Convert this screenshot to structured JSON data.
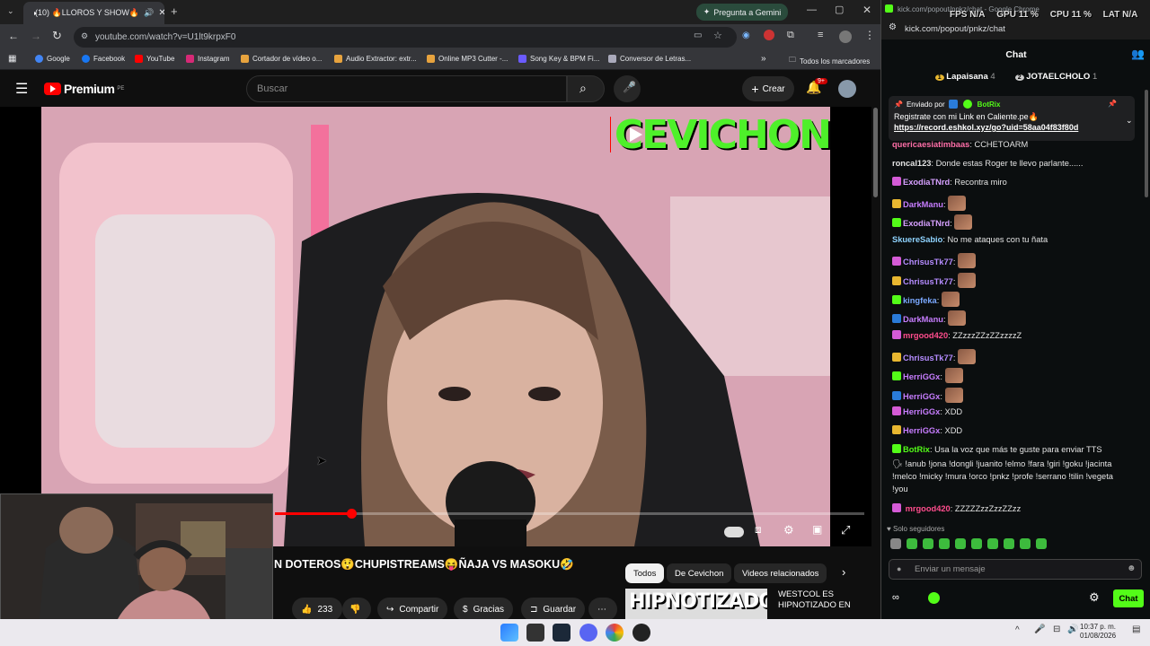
{
  "colors": {
    "youtube_red": "#ff0000",
    "kick_green": "#53fc18",
    "chat_green": "#4ef02a"
  },
  "browser": {
    "tab_title": "(10) 🔥LLOROS Y SHOW🔥",
    "gemini_label": "Pregunta a Gemini",
    "url": "youtube.com/watch?v=U1lt9krpxF0",
    "bookmarks": [
      "Google",
      "Facebook",
      "YouTube",
      "Instagram",
      "Cortador de vídeo o...",
      "Audio Extractor: extr...",
      "Online MP3 Cutter -...",
      "Song Key & BPM Fi...",
      "Conversor de Letras..."
    ],
    "all_bookmarks": "Todos los marcadores",
    "notif_badge": "9+"
  },
  "youtube": {
    "logo": "Premium",
    "logo_region": "PE",
    "search_placeholder": "Buscar",
    "create_label": "Crear",
    "notif_count": "9+",
    "overlay_logo_text": "CEVICHON",
    "progress": 0.13,
    "video_title": "N DOTEROS😲CHUPISTREAMS😝ÑAJA VS MASOKU🤣",
    "chips": [
      "Todos",
      "De Cevichon",
      "Videos relacionados"
    ],
    "likes": "233",
    "share": "Compartir",
    "thanks": "Gracias",
    "save": "Guardar",
    "rec_title": "WESTCOL ES HIPNOTIZADO EN",
    "rec_thumb_text": "HIPNOTIZADO"
  },
  "kick": {
    "window_title": "kick.com/popout/pnkz/chat - Google Chrome",
    "url": "kick.com/popout/pnkz/chat",
    "overlay": {
      "fps_label": "FPS",
      "fps": "N/A",
      "gpu_label": "GPU",
      "gpu": "11 %",
      "cpu_label": "CPU",
      "cpu": "11 %",
      "lat_label": "LAT",
      "lat": "N/A"
    },
    "chat_title": "Chat",
    "top1": {
      "rank": "1",
      "name": "Lapaisana",
      "count": "4"
    },
    "top2": {
      "rank": "2",
      "name": "JOTAELCHOLO",
      "count": "1"
    },
    "pinned_by": "Enviado por",
    "pinned_user": "BotRix",
    "pinned_text": "Registrate con mi Link en Caliente.pe🔥",
    "pinned_link": "https://record.eshkol.xyz/go?uid=58aa04f83f80d",
    "partial_user": "quericaesiatimbaas",
    "partial_text": "CCHETOARM",
    "messages": [
      {
        "user": "roncal123",
        "text": "Donde estas Roger te llevo parlante......",
        "color": "#e4e4e4"
      },
      {
        "user": "ExodiaTNrd",
        "text": "Recontra miro",
        "color": "#d6a0ff"
      },
      {
        "user": "DarkManu",
        "text": "",
        "color": "#c77dff"
      },
      {
        "user": "ExodiaTNrd",
        "text": "",
        "color": "#d6a0ff"
      },
      {
        "user": "SkuereSabio",
        "text": "No me ataques con tu ñata",
        "color": "#8fd3ff"
      },
      {
        "user": "ChrisusTk77",
        "text": "",
        "color": "#b58cff"
      },
      {
        "user": "ChrisusTk77",
        "text": "",
        "color": "#b58cff"
      },
      {
        "user": "kingfeka",
        "text": "",
        "color": "#7aa8ff"
      },
      {
        "user": "DarkManu",
        "text": "",
        "color": "#c77dff"
      },
      {
        "user": "mrgood420",
        "text": "ZZzzzZZzZZzzzzZ",
        "color": "#ff4d8d"
      },
      {
        "user": "ChrisusTk77",
        "text": "",
        "color": "#b58cff"
      },
      {
        "user": "HerriGGx",
        "text": "",
        "color": "#c77dff"
      },
      {
        "user": "HerriGGx",
        "text": "",
        "color": "#c77dff"
      },
      {
        "user": "HerriGGx",
        "text": "XDD",
        "color": "#c77dff"
      },
      {
        "user": "HerriGGx",
        "text": "XDD",
        "color": "#c77dff"
      },
      {
        "user": "BotRix",
        "text": "Usa la voz que más te guste para enviar TTS",
        "color": "#53fc18"
      }
    ],
    "botrix_line2": "🗣 !anub !jona !dongli !juanito !elmo !fara !giri !goku !jacinta",
    "botrix_line3": "!melco !micky !mura !orco !pnkz !profe !serrano !tilin !vegeta",
    "botrix_line4": "!you",
    "last_user": "mrgood420",
    "last_text": "ZZZZZzzZzzZZzz",
    "followers_only": "Solo seguidores",
    "input_placeholder": "Enviar un mensaje",
    "send_label": "Chat"
  },
  "taskbar": {
    "time": "10:37 p. m.",
    "date": "01/08/2026"
  }
}
